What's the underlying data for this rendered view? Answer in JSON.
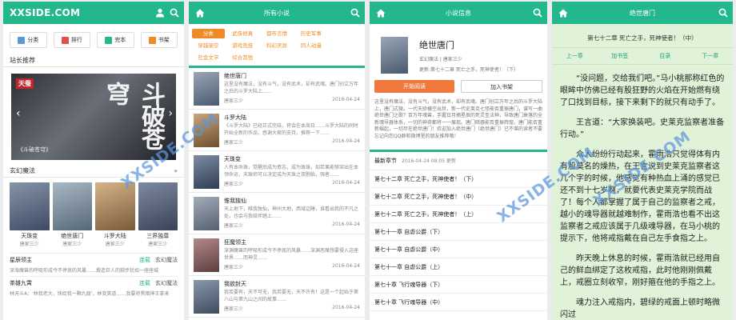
{
  "colors": {
    "accent": "#23b78e",
    "orange": "#f08a24",
    "read": "#f0783c",
    "reader_bg": "#e0f2d8"
  },
  "home": {
    "logo": "XXSIDE.COM",
    "quick_links": [
      {
        "label": "分类",
        "icon": "grid-icon",
        "color": "#5b9bd5"
      },
      {
        "label": "排行",
        "icon": "rank-icon",
        "color": "#e05050"
      },
      {
        "label": "完本",
        "icon": "book-icon",
        "color": "#23b78e"
      },
      {
        "label": "书架",
        "icon": "shelf-icon",
        "color": "#f08a24"
      }
    ],
    "recommend_title": "站长推荐",
    "carousel_caption": "《斗破苍穹》",
    "carousel_big": "斗破苍穹",
    "carousel_tag": "天蚕",
    "section_title": "玄幻魔法",
    "section_more": "»",
    "covers": [
      {
        "title": "天珠变",
        "author": "唐家三少",
        "color": "#3e4a63"
      },
      {
        "title": "绝世唐门",
        "author": "唐家三少",
        "color": "#566778"
      },
      {
        "title": "斗罗大陆",
        "author": "唐家三少",
        "color": "#7b5a3a"
      },
      {
        "title": "三界独尊",
        "author": "唐家三少",
        "color": "#394255"
      }
    ],
    "list": [
      {
        "title": "星辰领主",
        "status": "连载",
        "category": "玄幻魔法",
        "desc": "深海魔兽的呼吸形成今不停息的风暴……煅造巨人的脚步犹如一座座城"
      },
      {
        "title": "茶雄九霄",
        "status": "连载",
        "category": "玄幻魔法",
        "desc": "林天斗A：'林我老大，快给我一颗九级'，林我笑道……我要将黑暗神王拿来"
      }
    ]
  },
  "catalog": {
    "title": "所有小说",
    "categories": [
      "分类",
      "武侠修真",
      "都市言情",
      "历史军事",
      "穿越架空",
      "游戏竞技",
      "科幻灵异",
      "同人动漫",
      "社会文学",
      "综合其他"
    ],
    "books": [
      {
        "title": "绝世唐门",
        "desc": "这里没有魔法，没有斗气，没有武术，却有武魂。唐门创立万年之后的斗罗大陆上……",
        "author": "唐家三少",
        "date": "2016-04-24",
        "color": "#4a5a6e"
      },
      {
        "title": "斗罗大陆",
        "desc": "《斗罗大陆》已经正式完结，将会在本周日……斗罗大陆的同时开始全新的作品，感谢大家的支持，推荐一下……",
        "author": "唐家三少",
        "date": "2016-04-24",
        "color": "#6e4e30"
      },
      {
        "title": "天珠变",
        "desc": "人有本命珠，觉醒后成为意志，成为珠珠，如若果能够突出在本领命运，天珠师可以决定成为天珠之双胞胎，强者……",
        "author": "唐家三少",
        "date": "2016-04-24",
        "color": "#2f3d52"
      },
      {
        "title": "惟我独仙",
        "desc": "天上地下，唯我独仙，神州大地，西域边陲，谁看出我的不凡之处，也会与我结伴踏上……",
        "author": "唐家三少",
        "date": "2016-04-24",
        "color": "#556070"
      },
      {
        "title": "狂魔领主",
        "desc": "深渊魔兽的呼吸形成今不停息的风暴……深渊恶魔想要侵入这座世界……而神灵……",
        "author": "唐家三少",
        "date": "2016-04-24",
        "color": "#5c3f3f"
      },
      {
        "title": "我欲封天",
        "desc": "我若要有，天不可无，我若要无，天不许有！这是一个起始于第八山与第九山之间的故事……",
        "author": "唐家三少",
        "date": "2016-04-24",
        "color": "#3f4c5e"
      }
    ]
  },
  "detail": {
    "title": "小说信息",
    "book_title": "绝世唐门",
    "category": "玄幻魔法",
    "author": "唐家三少",
    "update_prefix": "更新:",
    "update_value": "第七十二章 死亡之手，死神使者！（下）",
    "read_btn": "开始阅读",
    "add_btn": "加入书架",
    "intro": "这里没有魔法，没有斗气，没有武术，却有武魂。唐门创立万年之后的斗罗大陆上，唐门式微。一代天骄横空出世，新一代史莱克七怪能否重振唐门，谱写一曲绝世唐门之歌？百万年魂兽，手握日月摘星辰的死灵圣法神，导致唐门衰落的全新魂导器体系，一切的神奇都将一一展现。唐门暗器能否重振辉煌，唐门能否重新崛起，一切尽在绝世唐门！欢迎加入绝世唐门（绝世唐门）已不堪的读者不要忘记向您QQ群和微博里的朋友推荐哦！",
    "latest_label": "最新章节",
    "latest_date": "2016-04-24 08:05 更新",
    "chapters": [
      "第七十二章 死亡之手，死神使者！（下）",
      "第七十二章 死亡之手，死神使者！（中）",
      "第七十二章 死亡之手，死神使者！（上）",
      "第七十一章 自虐公爵（下）",
      "第七十一章 自虐公爵（中）",
      "第七十一章 自虐公爵（上）",
      "第七十章 飞行魂导器（下）",
      "第七十章 飞行魂导器（中）"
    ]
  },
  "reader": {
    "title": "绝世唐门",
    "chapter_title": "第七十二章 死亡之手，死神使者！（中）",
    "nav": [
      "上一章",
      "加书签",
      "目录",
      "下一章"
    ],
    "paragraphs": [
      "“没问题，交给我们吧。”马小桃那称红色的眼眸中仿佛已经有股狂野的火焰在开始燃有绕了口找到目标，接下来剩下的就只有动手了。",
      "王言道：“大家换装吧。史莱克监察者准备行动。”",
      "众人纷纷行动起来，霍雨浩只觉得体有内有股莫名的燥热，在王言说到史莱克监察者这几个字的时候，他感觉有种热血上涌的感觉已还不到十七岁啊，就要代表史莱克学院而战了！每个人都掌握了属于自己的监察者之戒，越小的魂导器就越难制作，霍雨浩也看不出这监察者之戒应该属于几级魂导器，在马小桃的提示下，他将戒指戴在自己左手食指之上。",
      "昨天晚上休息的时候，霍雨浩就已经用自己的鲜血绑定了这枚戒指，此时他刚刚佩戴上，戒圈立刻收窄，刚好箍在他的手指之上。",
      "魂力注入戒指内，碧绿的戒面上顿时略微闪过"
    ]
  },
  "watermarks": [
    "XXSIDE.COM",
    "XXSIDE.COM",
    "XXSIDE.COM"
  ]
}
